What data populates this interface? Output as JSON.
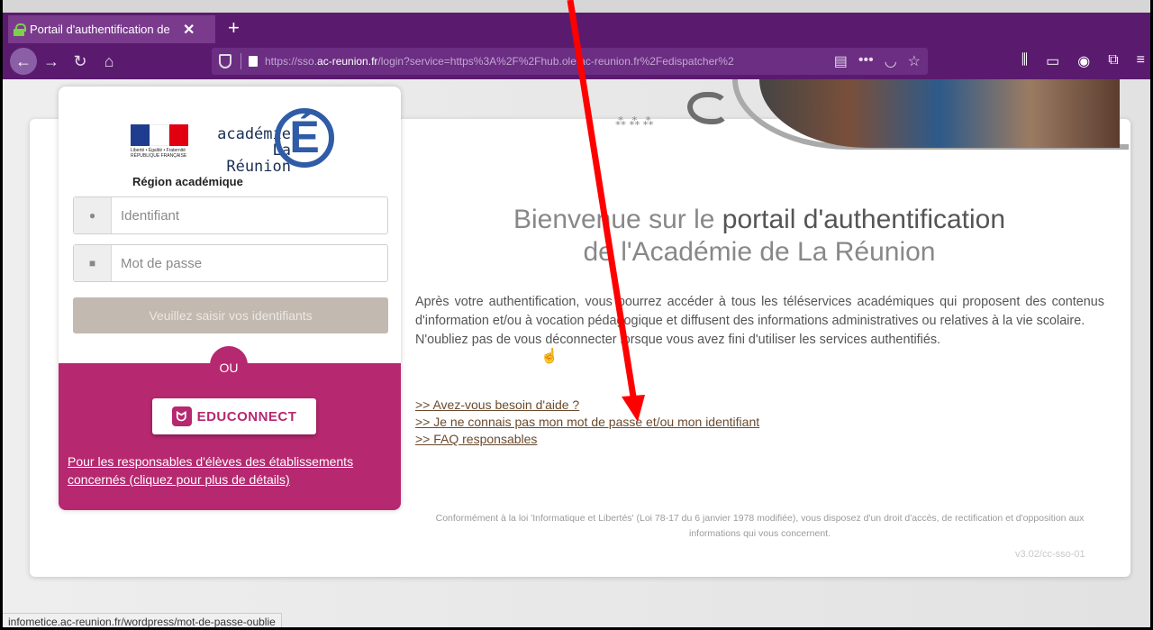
{
  "browser": {
    "tab_title": "Portail d'authentification de l'",
    "url_plain": "https://sso.",
    "url_domain": "ac-reunion.fr",
    "url_rest": "/login?service=https%3A%2F%2Fhub.ole.ac-reunion.fr%2Fedispatcher%2",
    "status_url": "infometice.ac-reunion.fr/wordpress/mot-de-passe-oublie"
  },
  "logo": {
    "flag_sub": "Liberté • Égalité • Fraternité RÉPUBLIQUE FRANÇAISE",
    "academie_line1": "académie",
    "academie_line2": "La Réunion",
    "big_letter": "É",
    "region": "Région académique"
  },
  "login": {
    "username_placeholder": "Identifiant",
    "password_placeholder": "Mot de passe",
    "submit_label": "Veuillez saisir vos identifiants",
    "or_label": "OU",
    "educonnect_label": "EDUCONNECT",
    "responsables_link": "Pour les responsables d'élèves des établissements concernés (cliquez pour plus de détails)"
  },
  "welcome": {
    "line1_light": "Bienvenue sur le ",
    "line1_bold": "portail d'authentification",
    "line2": "de l'Académie de La Réunion"
  },
  "intro": {
    "paragraph": "Après votre authentification, vous pourrez accéder à tous les téléservices académiques qui proposent des contenus d'information et/ou à vocation pédagogique et diffusent des informations administratives ou relatives à la vie scolaire.",
    "reminder": "N'oubliez pas de vous déconnecter lorsque vous avez fini d'utiliser les services authentifiés."
  },
  "links": [
    ">> Avez-vous besoin d'aide ?",
    ">> Je ne connais pas mon mot de passe et/ou mon identifiant",
    ">> FAQ responsables"
  ],
  "footer": {
    "legal": "Conformément à la loi 'Informatique et Libertés' (Loi 78-17 du 6 janvier 1978 modifiée), vous disposez d'un droit d'accès, de rectification et d'opposition aux informations qui vous concernent.",
    "version": "v3.02/cc-sso-01"
  },
  "colors": {
    "browser_purple": "#5a1b6e",
    "educonnect_pink": "#b6286f",
    "annotation_arrow": "#ff0000"
  }
}
